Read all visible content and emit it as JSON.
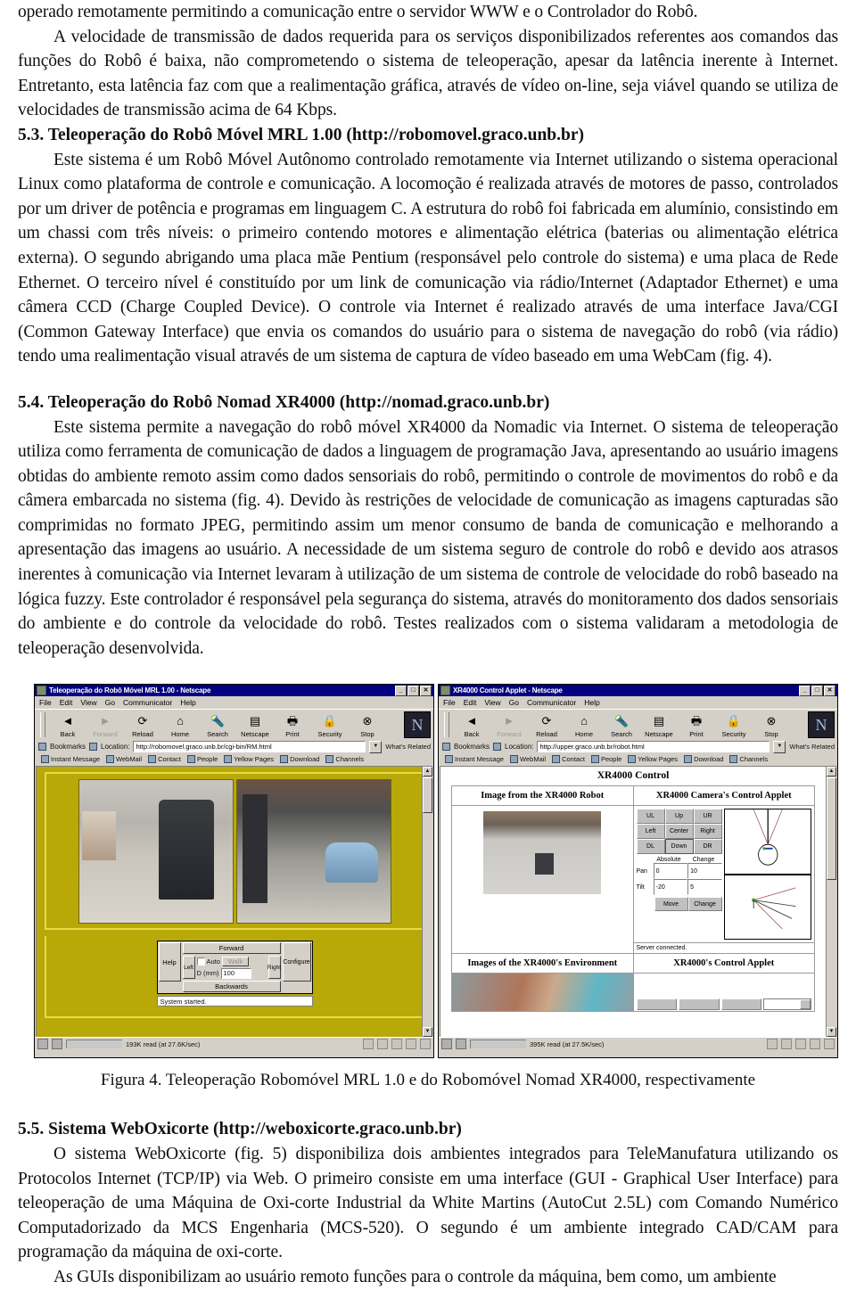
{
  "document": {
    "paragraphs": [
      "operado remotamente permitindo a comunicação entre o servidor WWW e o Controlador do Robô.",
      "A velocidade de transmissão de dados requerida para os serviços disponibilizados referentes aos comandos das funções do Robô é baixa, não comprometendo o sistema de teleoperação, apesar da latência inerente à Internet. Entretanto, esta latência faz com que a realimentação gráfica, através de vídeo on-line, seja viável quando se utiliza de velocidades de transmissão acima de 64 Kbps."
    ],
    "section_53": {
      "heading": "5.3. Teleoperação do Robô Móvel MRL 1.00 (http://robomovel.graco.unb.br)",
      "body": "Este sistema é um Robô Móvel Autônomo controlado remotamente via Internet utilizando o sistema operacional Linux como plataforma de controle e comunicação. A locomoção é realizada através de motores de passo, controlados por um driver de potência e programas em linguagem C. A estrutura do robô foi fabricada em alumínio, consistindo em um chassi com três níveis: o primeiro contendo motores e alimentação elétrica (baterias ou alimentação elétrica externa). O segundo abrigando uma placa mãe Pentium (responsável pelo controle do sistema) e uma placa de Rede Ethernet. O terceiro nível é constituído por um link de comunicação via rádio/Internet (Adaptador Ethernet) e uma câmera CCD (Charge Coupled Device). O controle via Internet é realizado através de uma interface Java/CGI (Common Gateway Interface) que envia os comandos do usuário para o sistema de navegação do robô (via rádio) tendo uma realimentação visual através de um sistema de captura de vídeo baseado em uma WebCam (fig. 4)."
    },
    "section_54": {
      "heading": "5.4. Teleoperação do Robô Nomad XR4000 (http://nomad.graco.unb.br)",
      "body": "Este sistema permite a navegação do robô móvel XR4000 da Nomadic via Internet. O sistema de teleoperação utiliza como ferramenta de comunicação de dados a linguagem de programação Java, apresentando ao usuário imagens obtidas do ambiente remoto assim como dados sensoriais do robô, permitindo o controle de movimentos do robô e da câmera embarcada no sistema (fig. 4). Devido às restrições de velocidade de comunicação as imagens capturadas são comprimidas no formato JPEG, permitindo assim um menor consumo de banda de comunicação e melhorando a apresentação das imagens ao usuário. A necessidade de um sistema seguro de controle do robô e devido aos atrasos inerentes à comunicação via Internet levaram à utilização de um sistema de controle de velocidade do robô baseado na lógica fuzzy. Este controlador é responsável pela segurança do sistema, através do monitoramento dos dados sensoriais do ambiente e do controle da velocidade do robô. Testes realizados com o sistema validaram a metodologia de teleoperação desenvolvida."
    },
    "figure_caption": "Figura 4. Teleoperação Robomóvel MRL 1.0 e do Robomóvel Nomad XR4000, respectivamente",
    "section_55": {
      "heading": "5.5. Sistema WebOxicorte (http://weboxicorte.graco.unb.br)",
      "body1": "O sistema WebOxicorte (fig. 5) disponibiliza dois ambientes integrados para TeleManufatura utilizando os Protocolos Internet (TCP/IP) via Web. O primeiro consiste em uma interface (GUI - Graphical User Interface) para teleoperação de uma Máquina de Oxi-corte Industrial da White Martins (AutoCut 2.5L) com Comando Numérico Computadorizado da MCS Engenharia (MCS-520). O segundo é um ambiente integrado CAD/CAM para programação da máquina de oxi-corte.",
      "body2": "As GUIs disponibilizam ao usuário remoto funções para o controle da máquina, bem como, um ambiente"
    }
  },
  "figure": {
    "left_window": {
      "title": "Teleoperação do Robô Móvel MRL 1.00 - Netscape",
      "window_buttons": [
        "_",
        "□",
        "✕"
      ],
      "menus": [
        "File",
        "Edit",
        "View",
        "Go",
        "Communicator",
        "Help"
      ],
      "toolbar": [
        {
          "label": "Back",
          "icon": "back-arrow-icon",
          "glyph": "◄",
          "disabled": false
        },
        {
          "label": "Forward",
          "icon": "forward-arrow-icon",
          "glyph": "►",
          "disabled": true
        },
        {
          "label": "Reload",
          "icon": "reload-icon",
          "glyph": "⟳",
          "disabled": false
        },
        {
          "label": "Home",
          "icon": "home-icon",
          "glyph": "⌂",
          "disabled": false
        },
        {
          "label": "Search",
          "icon": "search-icon",
          "glyph": "🔦",
          "disabled": false
        },
        {
          "label": "Netscape",
          "icon": "netscape-icon",
          "glyph": "▤",
          "disabled": false
        },
        {
          "label": "Print",
          "icon": "print-icon",
          "glyph": "🖶",
          "disabled": false
        },
        {
          "label": "Security",
          "icon": "lock-icon",
          "glyph": "🔒",
          "disabled": false
        },
        {
          "label": "Stop",
          "icon": "stop-icon",
          "glyph": "⊗",
          "disabled": false
        }
      ],
      "bookmarks_label": "Bookmarks",
      "location_label": "Location:",
      "location_value": "http://robomovel.graco.unb.br/cgi-bin/RM.html",
      "whats_related": "What's Related",
      "personal_toolbar": [
        "Instant Message",
        "WebMail",
        "Contact",
        "People",
        "Yellow Pages",
        "Download",
        "Channels"
      ],
      "page": {
        "controls": {
          "help": "Help",
          "left": "Left",
          "right": "Right",
          "configure": "Configure",
          "forward": "Forward",
          "backwards": "Backwards",
          "auto_label": "Auto",
          "walk": "Walk",
          "distance_label": "D (mm)",
          "distance_value": "100"
        },
        "status": "System started."
      },
      "statusbar": "193K read (at 27.6K/sec)"
    },
    "right_window": {
      "title": "XR4000 Control Applet - Netscape",
      "window_buttons": [
        "_",
        "□",
        "✕"
      ],
      "menus": [
        "File",
        "Edit",
        "View",
        "Go",
        "Communicator",
        "Help"
      ],
      "toolbar": [
        {
          "label": "Back",
          "icon": "back-arrow-icon",
          "glyph": "◄",
          "disabled": false
        },
        {
          "label": "Forward",
          "icon": "forward-arrow-icon",
          "glyph": "►",
          "disabled": true
        },
        {
          "label": "Reload",
          "icon": "reload-icon",
          "glyph": "⟳",
          "disabled": false
        },
        {
          "label": "Home",
          "icon": "home-icon",
          "glyph": "⌂",
          "disabled": false
        },
        {
          "label": "Search",
          "icon": "search-icon",
          "glyph": "🔦",
          "disabled": false
        },
        {
          "label": "Netscape",
          "icon": "netscape-icon",
          "glyph": "▤",
          "disabled": false
        },
        {
          "label": "Print",
          "icon": "print-icon",
          "glyph": "🖶",
          "disabled": false
        },
        {
          "label": "Security",
          "icon": "lock-icon",
          "glyph": "🔒",
          "disabled": false
        },
        {
          "label": "Stop",
          "icon": "stop-icon",
          "glyph": "⊗",
          "disabled": false
        }
      ],
      "bookmarks_label": "Bookmarks",
      "location_label": "Location:",
      "location_value": "http://upper.graco.unb.br/robot.html",
      "whats_related": "What's Related",
      "personal_toolbar": [
        "Instant Message",
        "WebMail",
        "Contact",
        "People",
        "Yellow Pages",
        "Download",
        "Channels"
      ],
      "page": {
        "title": "XR4000 Control",
        "cell_header_1": "Image from the XR4000 Robot",
        "cell_header_2": "XR4000 Camera's Control Applet",
        "cell_header_3": "Images of the XR4000's Environment",
        "cell_header_4": "XR4000's Control Applet",
        "pad_buttons": [
          "UL",
          "Up",
          "UR",
          "Left",
          "Center",
          "Right",
          "DL",
          "Down",
          "DR"
        ],
        "pad_selected": "Down",
        "col_headers": [
          "Absolute",
          "Change"
        ],
        "rows": [
          {
            "label": "Pan",
            "absolute": "0",
            "change": "10"
          },
          {
            "label": "Tilt",
            "absolute": "-20",
            "change": "5"
          }
        ],
        "actions": [
          "Move",
          "Change"
        ],
        "status": "Server connected."
      },
      "statusbar": "395K read (at 27.5K/sec)"
    }
  },
  "colors": {
    "titlebar": "#000080",
    "chrome": "#d4d0c8",
    "page_yellow": "#b8a808",
    "yellow_border": "#e8dc46"
  }
}
